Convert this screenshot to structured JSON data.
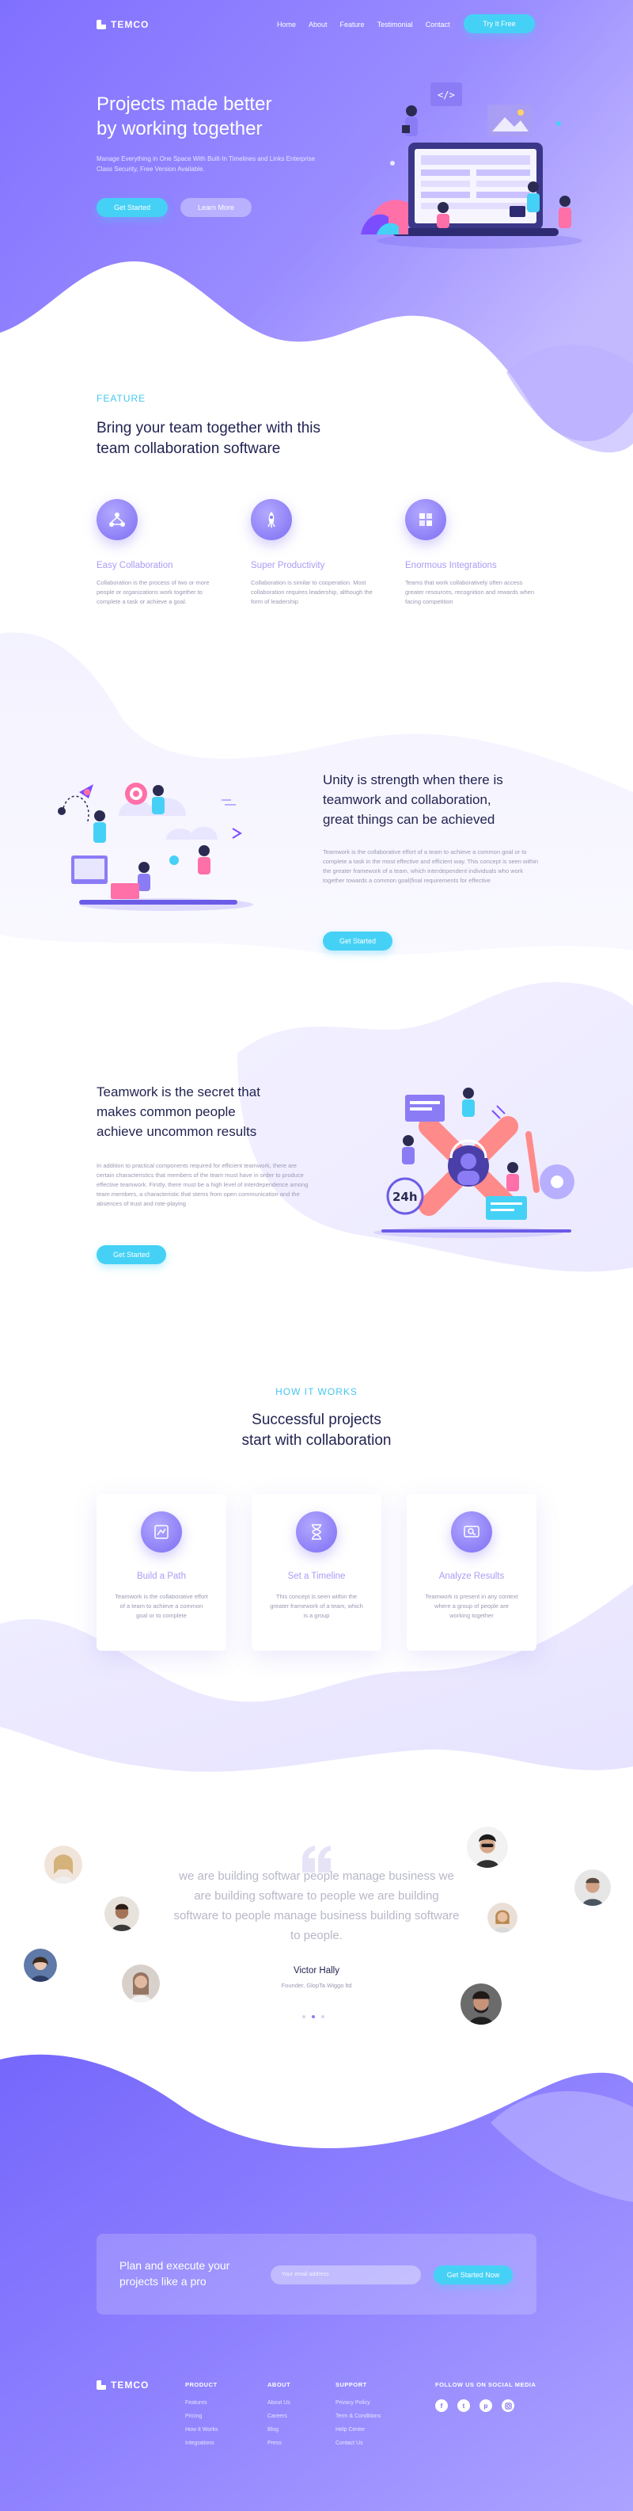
{
  "header": {
    "logo": "TEMCO",
    "nav": [
      "Home",
      "About",
      "Feature",
      "Testimonial",
      "Contact"
    ],
    "cta": "Try It Free"
  },
  "hero": {
    "title_line1": "Projects made better",
    "title_line2": "by working together",
    "subtitle": "Manage Everything in One Space With Built-In Timelines and Links Enterprise Class Security, Free Version Available.",
    "primary_button": "Get Started",
    "secondary_button": "Learn More"
  },
  "feature": {
    "eyebrow": "FEATURE",
    "title_line1": "Bring your team together with this",
    "title_line2": "team collaboration software",
    "items": [
      {
        "title": "Easy Collaboration",
        "text": "Collaboration is the process of two or more people or organizations work together to complete a task or achieve a goal.",
        "icon": "network-icon"
      },
      {
        "title": "Super Productivity",
        "text": "Collaboration is similar to cooperation. Most collaboration requires leadership, although the form of leadership",
        "icon": "rocket-icon"
      },
      {
        "title": "Enormous Integrations",
        "text": "Teams that work collaboratively often access greater resources, recognition and rewards when facing competition",
        "icon": "puzzle-icon"
      }
    ]
  },
  "unity": {
    "title_line1": "Unity is strength when there is",
    "title_line2": "teamwork and collaboration,",
    "title_line3": "great things can be achieved",
    "text": "Teamwork is the collaborative effort of a team to achieve a common goal or to complete a task in the most effective and efficient way. This concept is seen within the greater framework of a team, which interdependent individuals who work together towards a common goal(final requirements for effective",
    "button": "Get Started"
  },
  "secret": {
    "title_line1": "Teamwork is the secret that",
    "title_line2": "makes common people",
    "title_line3": "achieve uncommon results",
    "text": "In addition to practical components required for efficient teamwork, there are certain characteristics that members of the team must have in order to produce effective teamwork. Firstly, there must be a high level of interdependence among team members, a characteristic that stems from open communication and the absences of trust and rote-playing",
    "button": "Get Started"
  },
  "how": {
    "eyebrow": "HOW IT WORKS",
    "title_line1": "Successful projects",
    "title_line2": "start with collaboration",
    "cards": [
      {
        "title": "Build a Path",
        "text": "Teamwork is the collaborative effort of a team to achieve a common goal or to complete",
        "icon": "path-icon"
      },
      {
        "title": "Set a Timeline",
        "text": "This concept is seen within the greater framework of a team, which is a group",
        "icon": "hourglass-icon"
      },
      {
        "title": "Analyze Results",
        "text": "Teamwork is present in any context where a group of people are working together",
        "icon": "analytics-icon"
      }
    ]
  },
  "testimonial": {
    "quote": "we are building softwar people manage business we are building software to people we are building software to people manage business building software to people.",
    "name": "Victor Hally",
    "role": "Founder, GlopTa Wiggo ltd"
  },
  "cta": {
    "title_line1": "Plan and execute your",
    "title_line2": "projects like a pro",
    "placeholder": "Your email address",
    "button": "Get Started Now"
  },
  "footer": {
    "logo": "TEMCO",
    "columns": [
      {
        "heading": "PRODUCT",
        "links": [
          "Features",
          "Pricing",
          "How It Works",
          "Integrations"
        ]
      },
      {
        "heading": "ABOUT",
        "links": [
          "About Us",
          "Careers",
          "Blog",
          "Press"
        ]
      },
      {
        "heading": "SUPPORT",
        "links": [
          "Privacy Policy",
          "Term & Conditions",
          "Help Center",
          "Contact Us"
        ]
      }
    ],
    "social_heading": "FOLLOW US ON SOCIAL MEDIA",
    "social_icons": [
      "facebook-icon",
      "twitter-icon",
      "pinterest-icon",
      "instagram-icon"
    ]
  },
  "colors": {
    "brand_purple": "#8a7cff",
    "accent_cyan": "#45d1f5",
    "heading_navy": "#232352",
    "feature_title": "#a99df4"
  }
}
